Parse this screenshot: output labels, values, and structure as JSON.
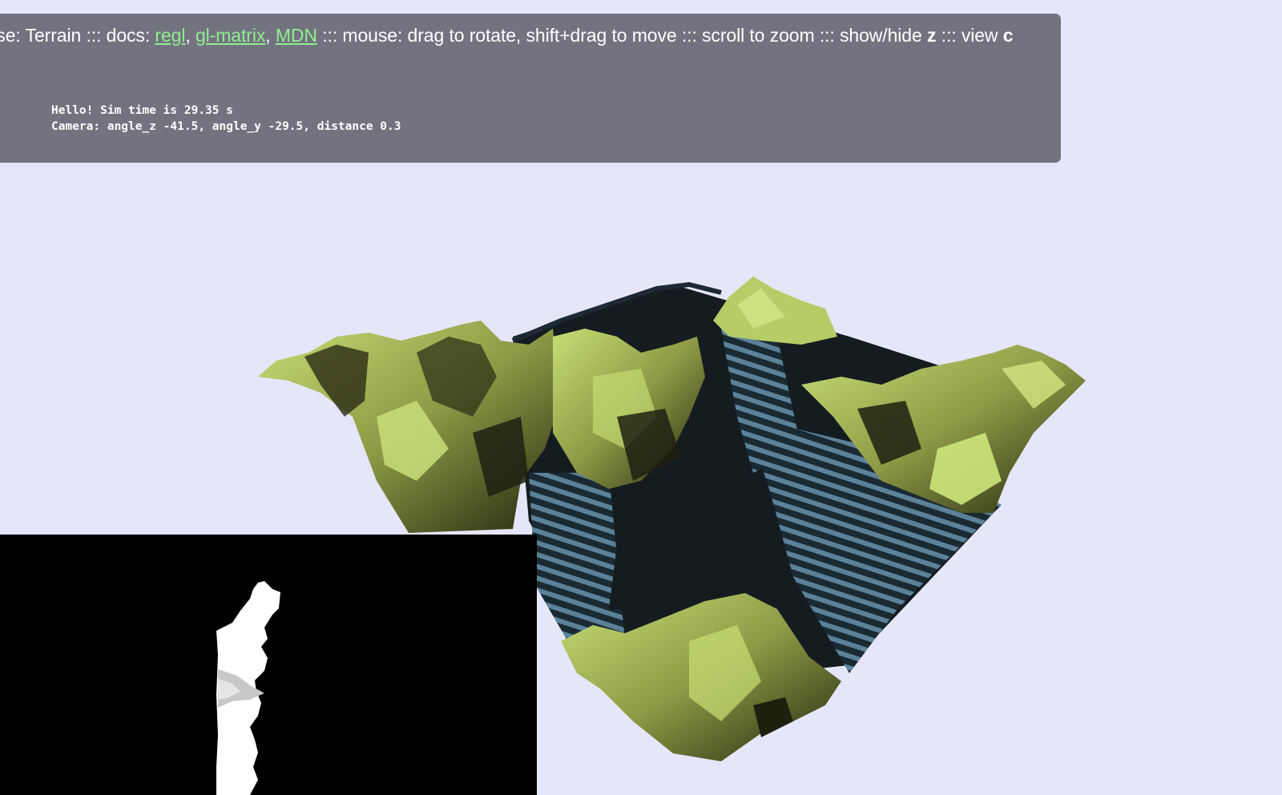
{
  "header": {
    "title_prefix": "Exercise: Terrain",
    "sep": ":::",
    "docs_label": "docs:",
    "links": [
      {
        "label": "regl"
      },
      {
        "label": "gl-matrix"
      },
      {
        "label": "MDN"
      }
    ],
    "mouse_hint": "mouse: drag to rotate, shift+drag to move",
    "scroll_hint": "scroll to zoom",
    "toggle_hint_prefix": "show/hide",
    "toggle_key": "z",
    "view_hint_prefix": "view",
    "view_key": "c"
  },
  "debug": {
    "line1": "Hello! Sim time is 29.35 s",
    "line2": "Camera: angle_z -41.5, angle_y -29.5, distance 0.3"
  },
  "colors": {
    "background": "#e6e6fa",
    "overlay": "#737380",
    "link": "#90ee90",
    "terrain_light": "#c5db72",
    "terrain_dark": "#1c1d10",
    "water": "#5a7f96"
  }
}
